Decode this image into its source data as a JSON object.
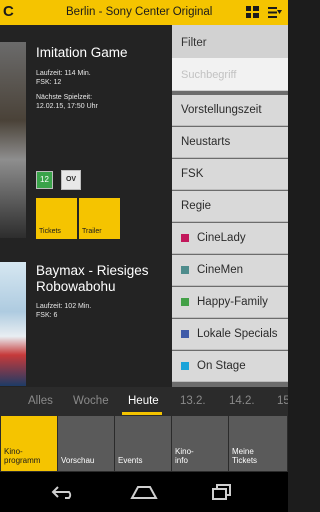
{
  "header": {
    "title": "Berlin - Sony Center Original",
    "logo_text": "C",
    "brand_color": "#f5c400"
  },
  "movies": [
    {
      "title": "Imitation Game",
      "runtime": "Laufzeit: 114 Min.",
      "fsk": "FSK: 12",
      "next_label": "Nächste Spielzeit:",
      "next_time": "12.02.15, 17:50 Uhr",
      "rating_badge": "12",
      "version_badge": "OV",
      "tickets_label": "Tickets",
      "trailer_label": "Trailer"
    },
    {
      "title_line1": "Baymax - Riesiges",
      "title_line2": "Robowabohu",
      "runtime": "Laufzeit: 102 Min.",
      "fsk": "FSK: 6"
    }
  ],
  "filter": {
    "title": "Filter",
    "search_placeholder": "Suchbegriff",
    "items": [
      "Vorstellungszeit",
      "Neustarts",
      "FSK",
      "Regie"
    ],
    "categories": [
      {
        "label": "CineLady",
        "color": "#c2185b"
      },
      {
        "label": "CineMen",
        "color": "#4e8c8c"
      },
      {
        "label": "Happy-Family",
        "color": "#43a047"
      },
      {
        "label": "Lokale Specials",
        "color": "#3f5aa8"
      },
      {
        "label": "On Stage",
        "color": "#1aa3d9"
      }
    ]
  },
  "days": [
    "Alles",
    "Woche",
    "Heute",
    "13.2.",
    "14.2.",
    "15"
  ],
  "active_day": "Heute",
  "nav": [
    {
      "line1": "Kino-",
      "line2": "programm",
      "active": true
    },
    {
      "line1": "",
      "line2": "Vorschau",
      "active": false
    },
    {
      "line1": "",
      "line2": "Events",
      "active": false
    },
    {
      "line1": "Kino-",
      "line2": "info",
      "active": false
    },
    {
      "line1": "Meine",
      "line2": "Tickets",
      "active": false
    }
  ],
  "system_icons": [
    "back-icon",
    "home-icon",
    "recent-apps-icon"
  ]
}
